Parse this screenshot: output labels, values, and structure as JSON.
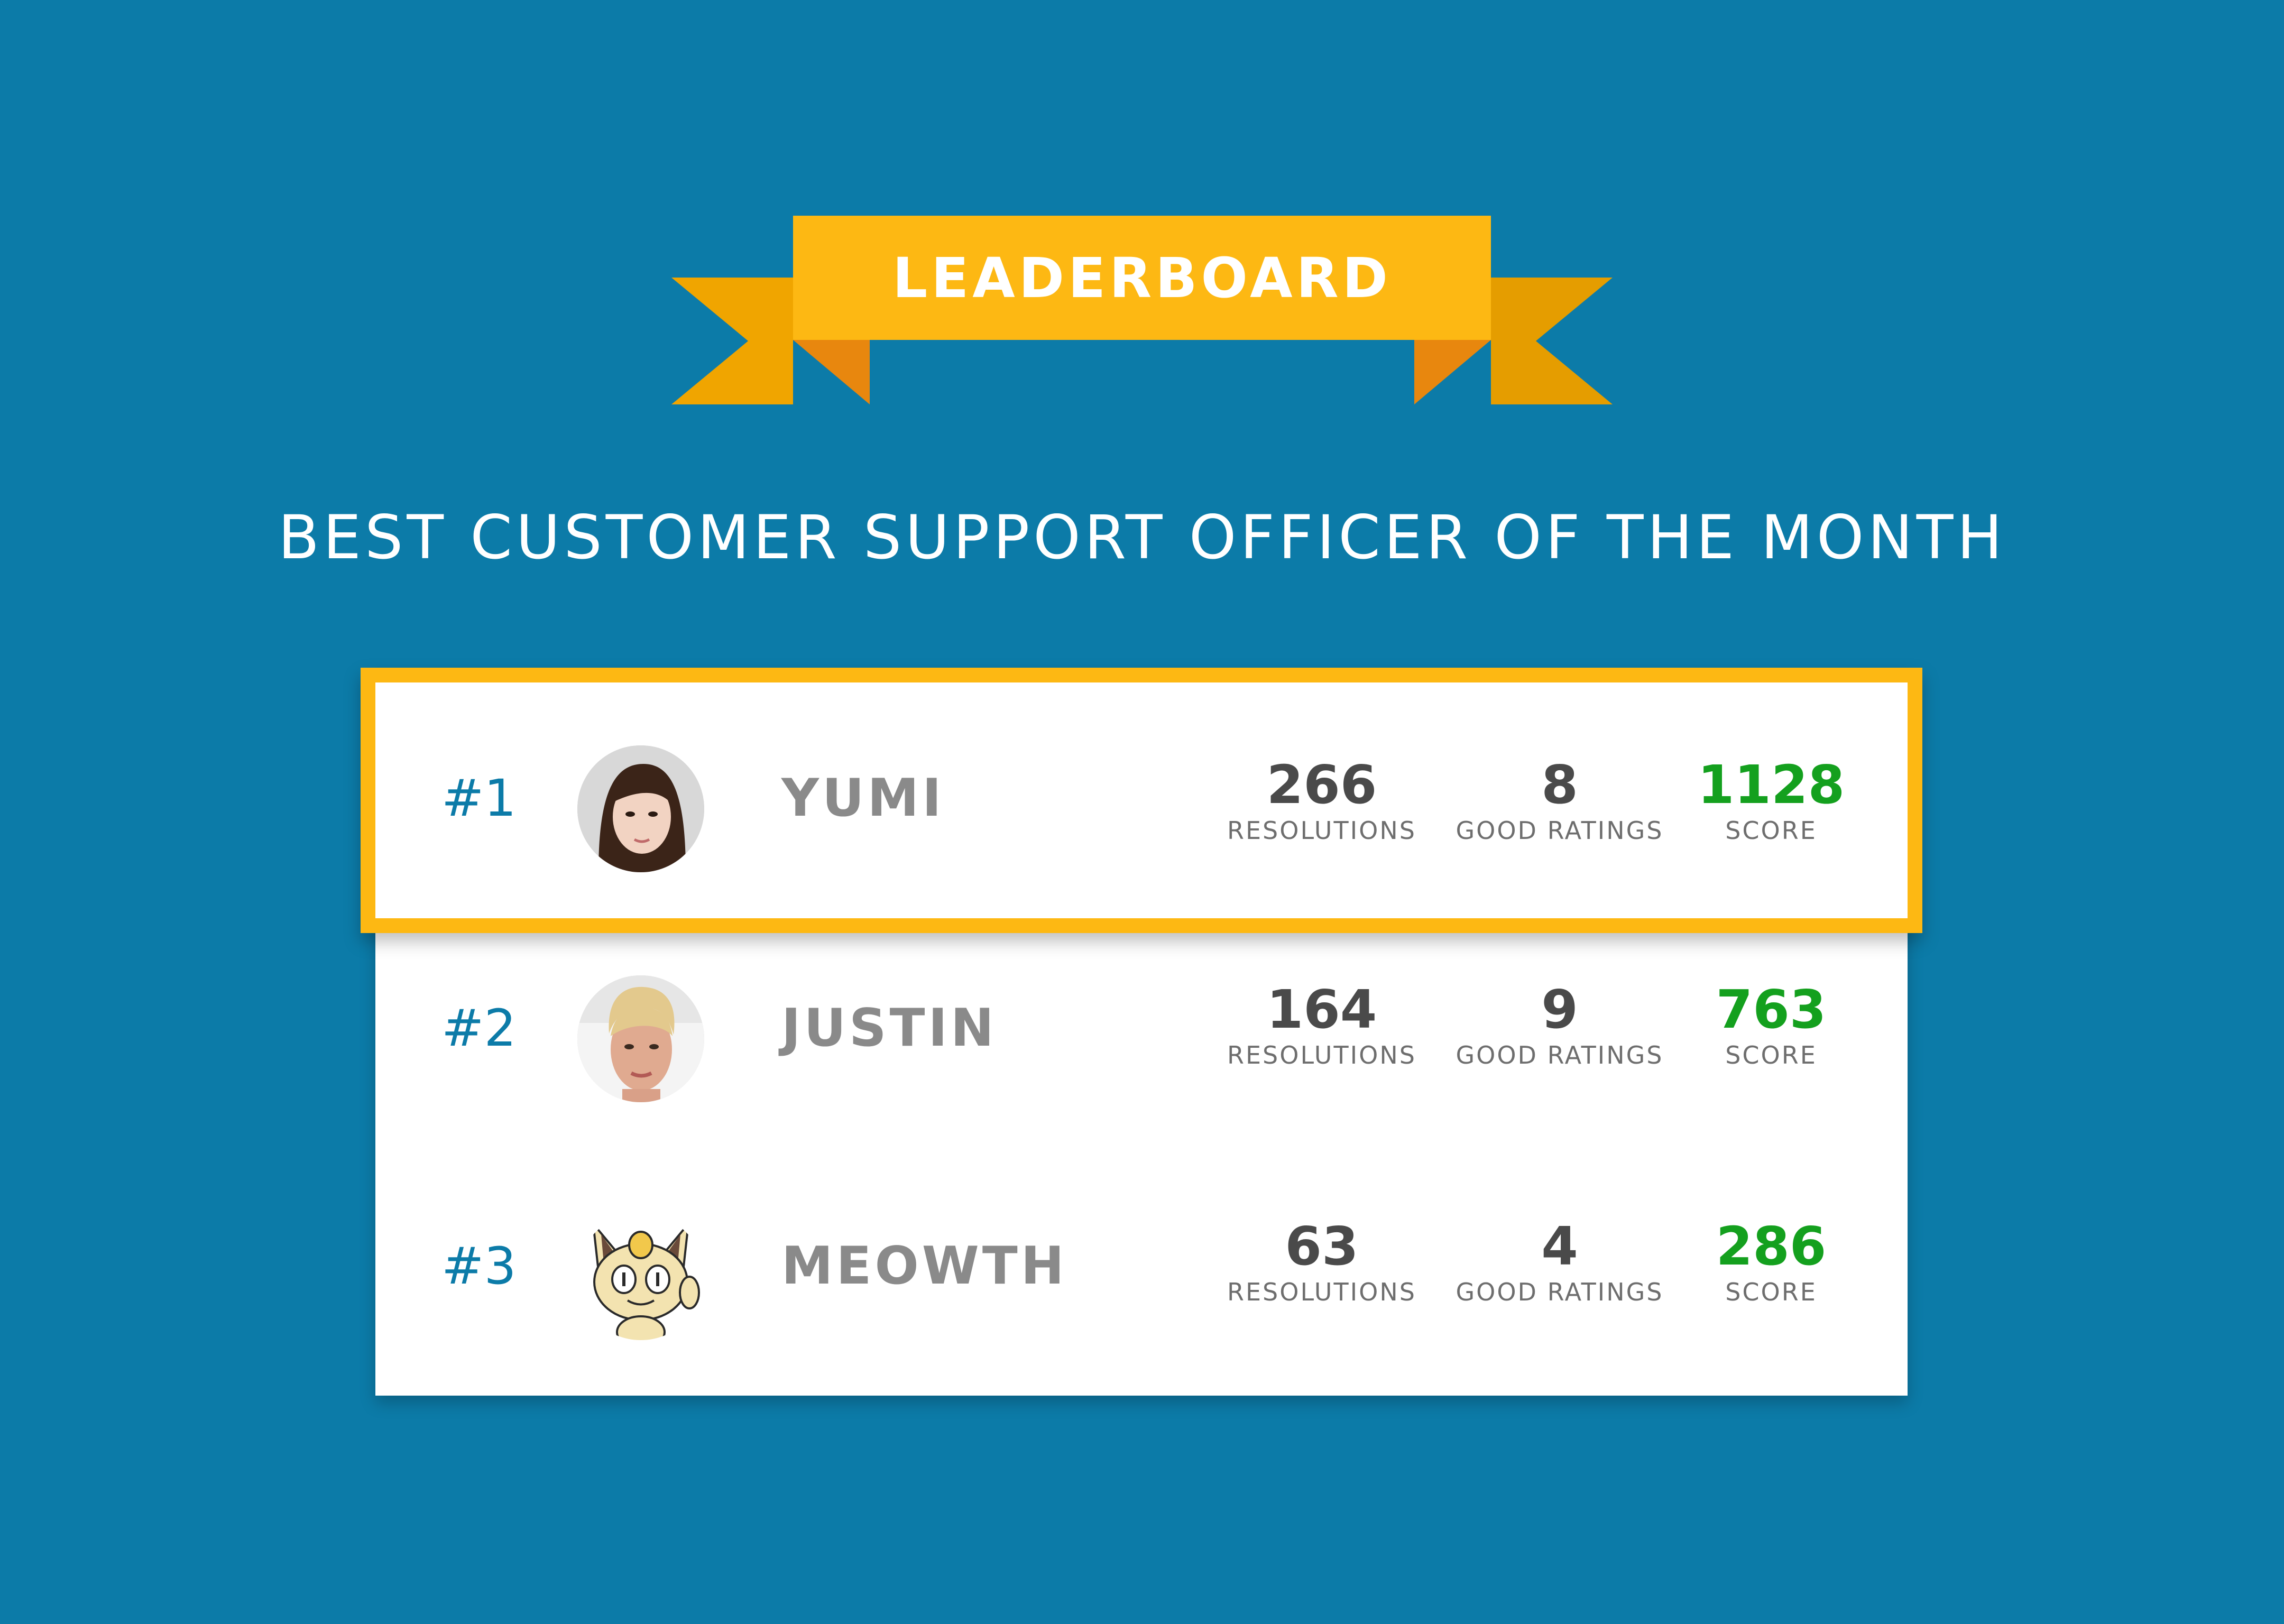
{
  "banner": {
    "title": "LEADERBOARD",
    "ribbon_color": "#fdb813",
    "ribbon_dark_color": "#f0a500",
    "ribbon_fold_color": "#e8870e"
  },
  "subtitle": "BEST CUSTOMER SUPPORT OFFICER OF THE MONTH",
  "colors": {
    "background": "#0c7ba8",
    "rank": "#0c7ba8",
    "score": "#14a01e",
    "highlight_border": "#fdb813"
  },
  "labels": {
    "resolutions": "RESOLUTIONS",
    "good_ratings": "GOOD RATINGS",
    "score": "SCORE"
  },
  "entries": [
    {
      "rank": "#1",
      "name": "YUMI",
      "resolutions": "266",
      "good_ratings": "8",
      "score": "1128",
      "avatar": "yumi-avatar"
    },
    {
      "rank": "#2",
      "name": "JUSTIN",
      "resolutions": "164",
      "good_ratings": "9",
      "score": "763",
      "avatar": "justin-avatar"
    },
    {
      "rank": "#3",
      "name": "MEOWTH",
      "resolutions": "63",
      "good_ratings": "4",
      "score": "286",
      "avatar": "meowth-avatar"
    }
  ]
}
